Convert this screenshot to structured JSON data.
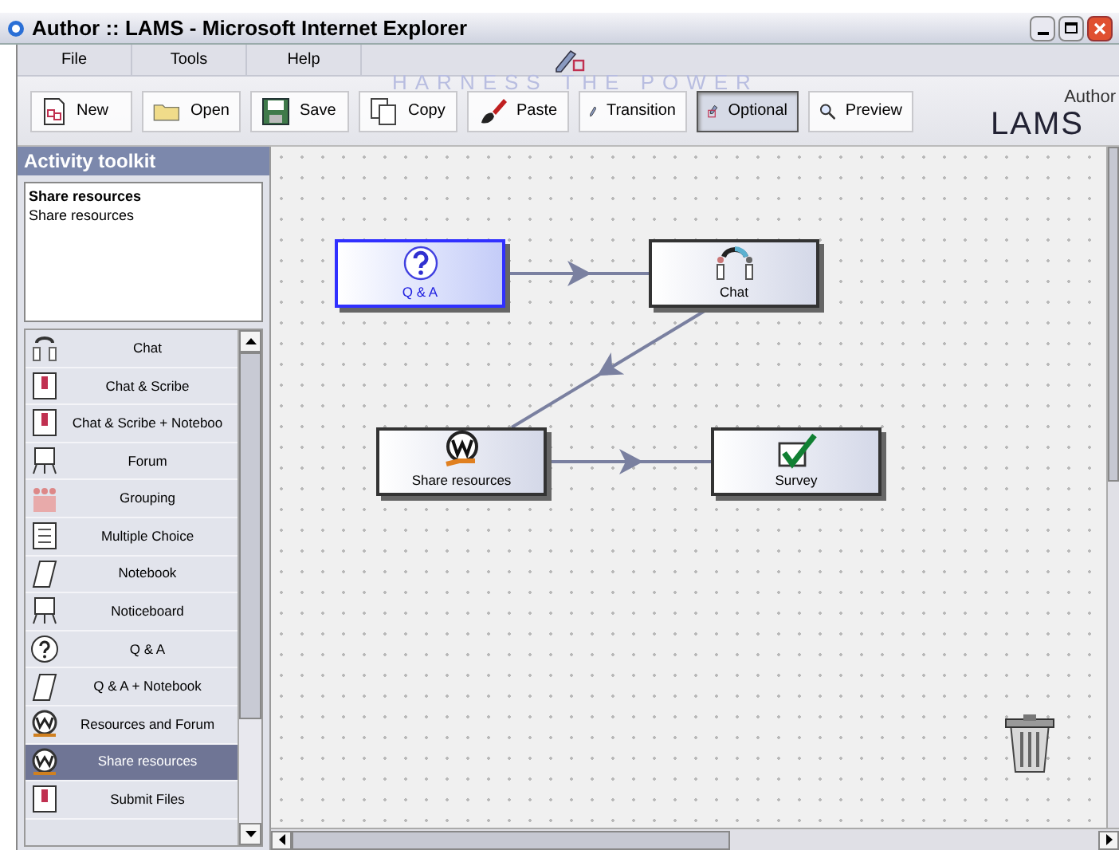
{
  "window": {
    "title": "Author :: LAMS - Microsoft Internet Explorer"
  },
  "menu": [
    "File",
    "Tools",
    "Help"
  ],
  "banner": {
    "slogan": "HARNESS THE POWER",
    "label": "Author",
    "logo": "LAMS"
  },
  "toolbar": [
    {
      "label": "New",
      "selected": false
    },
    {
      "label": "Open",
      "selected": false
    },
    {
      "label": "Save",
      "selected": false
    },
    {
      "label": "Copy",
      "selected": false
    },
    {
      "label": "Paste",
      "selected": false
    },
    {
      "label": "Transition",
      "selected": false
    },
    {
      "label": "Optional",
      "selected": true
    },
    {
      "label": "Preview",
      "selected": false
    }
  ],
  "toolkit": {
    "title": "Activity toolkit",
    "description": {
      "heading": "Share resources",
      "text": "Share resources"
    },
    "items": [
      {
        "label": "Chat",
        "selected": false
      },
      {
        "label": "Chat & Scribe",
        "selected": false
      },
      {
        "label": "Chat & Scribe + Noteboo",
        "selected": false
      },
      {
        "label": "Forum",
        "selected": false
      },
      {
        "label": "Grouping",
        "selected": false
      },
      {
        "label": "Multiple Choice",
        "selected": false
      },
      {
        "label": "Notebook",
        "selected": false
      },
      {
        "label": "Noticeboard",
        "selected": false
      },
      {
        "label": "Q & A",
        "selected": false
      },
      {
        "label": "Q & A + Notebook",
        "selected": false
      },
      {
        "label": "Resources and Forum",
        "selected": false
      },
      {
        "label": "Share resources",
        "selected": true
      },
      {
        "label": "Submit Files",
        "selected": false
      }
    ]
  },
  "canvas": {
    "activities": [
      {
        "label": "Q & A",
        "kind": "question",
        "selected": true
      },
      {
        "label": "Chat",
        "kind": "chat",
        "selected": false
      },
      {
        "label": "Share resources",
        "kind": "resources",
        "selected": false
      },
      {
        "label": "Survey",
        "kind": "survey",
        "selected": false
      }
    ]
  }
}
